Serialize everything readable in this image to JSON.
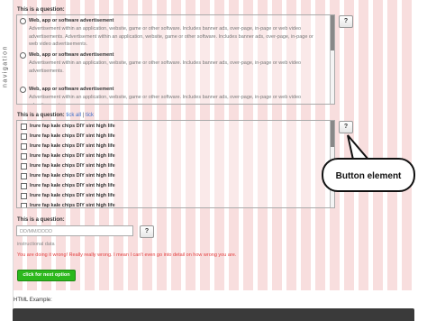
{
  "sidebar": {
    "label": "navigation"
  },
  "question1": {
    "label": "This is a question:",
    "help": "?",
    "options": [
      {
        "title": "Web, app or software advertisement",
        "desc": "Advertisement within an application, website, game or other software. Includes banner ads, over-page, in-page or web video advertisements. Advertisement within an application, website, game or other software. Includes banner ads, over-page, in-page or web video advertisements."
      },
      {
        "title": "Web, app or software advertisement",
        "desc": "Advertisement within an application, website, game or other software. Includes banner ads, over-page, in-page or web video advertisements."
      },
      {
        "title": "Web, app or software advertisement",
        "desc": "Advertisement within an application, website, game or other software. Includes banner ads, over-page, in-page or web video advertisements."
      }
    ]
  },
  "question2": {
    "label": "This is a question:",
    "link_all": "tick all",
    "separator": "|",
    "link_none": "tick",
    "help": "?",
    "options": [
      "Irure fap kale chips DIY sint high life",
      "Irure fap kale chips DIY sint high life",
      "Irure fap kale chips DIY sint high life",
      "Irure fap kale chips DIY sint high life",
      "Irure fap kale chips DIY sint high life",
      "Irure fap kale chips DIY sint high life",
      "Irure fap kale chips DIY sint high life",
      "Irure fap kale chips DIY sint high life",
      "Irure fap kale chips DIY sint high life"
    ]
  },
  "question3": {
    "label": "This is a question:",
    "placeholder": "DD/MM/DDDD",
    "help": "?",
    "hint": "instructional data",
    "error": "You are doing it wrong! Really really wrong. I mean I can't even go into detail on how wrong you are."
  },
  "next_button": "click for next option",
  "html_example": "HTML Example:",
  "callout": "Button element"
}
